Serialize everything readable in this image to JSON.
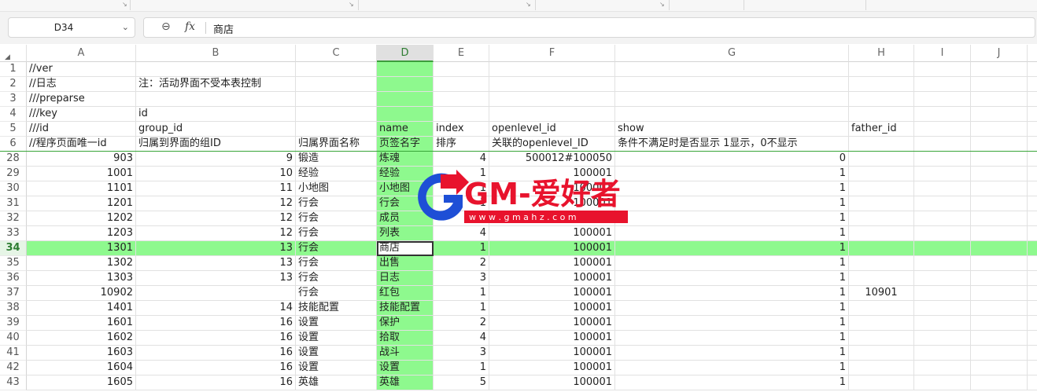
{
  "name_box": {
    "cell_ref": "D34"
  },
  "formula_bar": {
    "content": "商店"
  },
  "icons": {
    "zoom": "zoom-icon",
    "fx": "function-icon",
    "dropdown": "chevron-down-icon"
  },
  "columns": [
    "A",
    "B",
    "C",
    "D",
    "E",
    "F",
    "G",
    "H",
    "I",
    "J"
  ],
  "selected_column": "D",
  "selected_row": "34",
  "colors": {
    "highlight": "#8ef98e",
    "accent": "#2e7d32",
    "logo_red": "#e8132d"
  },
  "header_rows": [
    {
      "num": "1",
      "A": "//ver"
    },
    {
      "num": "2",
      "A": "//日志",
      "B": "注：活动界面不受本表控制"
    },
    {
      "num": "3",
      "A": "///preparse"
    },
    {
      "num": "4",
      "A": "///key",
      "B": "id"
    },
    {
      "num": "5",
      "A": "///id",
      "B": "group_id",
      "D": "name",
      "E": "index",
      "F": "openlevel_id",
      "G": "show",
      "H": "father_id"
    },
    {
      "num": "6",
      "A": "//程序页面唯一id",
      "B": "归属到界面的组ID",
      "C": "归属界面名称",
      "D": "页签名字",
      "E": "排序",
      "F": "关联的openlevel_ID",
      "G": "条件不满足时是否显示 1显示，0不显示"
    }
  ],
  "data_rows": [
    {
      "num": "28",
      "A": "903",
      "B": "9",
      "C": "锻造",
      "D": "炼魂",
      "E": "4",
      "F": "500012#100050",
      "G": "0"
    },
    {
      "num": "29",
      "A": "1001",
      "B": "10",
      "C": "经验",
      "D": "经验",
      "E": "1",
      "F": "100001",
      "G": "1"
    },
    {
      "num": "30",
      "A": "1101",
      "B": "11",
      "C": "小地图",
      "D": "小地图",
      "E": "1",
      "F": "100001",
      "G": "1"
    },
    {
      "num": "31",
      "A": "1201",
      "B": "12",
      "C": "行会",
      "D": "行会",
      "E": "1",
      "F": "100001",
      "G": "1"
    },
    {
      "num": "32",
      "A": "1202",
      "B": "12",
      "C": "行会",
      "D": "成员",
      "E": "2",
      "F": "100001",
      "G": "1"
    },
    {
      "num": "33",
      "A": "1203",
      "B": "12",
      "C": "行会",
      "D": "列表",
      "E": "4",
      "F": "100001",
      "G": "1"
    },
    {
      "num": "34",
      "A": "1301",
      "B": "13",
      "C": "行会",
      "D": "商店",
      "E": "1",
      "F": "100001",
      "G": "1"
    },
    {
      "num": "35",
      "A": "1302",
      "B": "13",
      "C": "行会",
      "D": "出售",
      "E": "2",
      "F": "100001",
      "G": "1"
    },
    {
      "num": "36",
      "A": "1303",
      "B": "13",
      "C": "行会",
      "D": "日志",
      "E": "3",
      "F": "100001",
      "G": "1"
    },
    {
      "num": "37",
      "A": "10902",
      "B": "",
      "C": "行会",
      "D": "红包",
      "E": "1",
      "F": "100001",
      "G": "1",
      "H": "10901"
    },
    {
      "num": "38",
      "A": "1401",
      "B": "14",
      "C": "技能配置",
      "D": "技能配置",
      "E": "1",
      "F": "100001",
      "G": "1"
    },
    {
      "num": "39",
      "A": "1601",
      "B": "16",
      "C": "设置",
      "D": "保护",
      "E": "2",
      "F": "100001",
      "G": "1"
    },
    {
      "num": "40",
      "A": "1602",
      "B": "16",
      "C": "设置",
      "D": "拾取",
      "E": "4",
      "F": "100001",
      "G": "1"
    },
    {
      "num": "41",
      "A": "1603",
      "B": "16",
      "C": "设置",
      "D": "战斗",
      "E": "3",
      "F": "100001",
      "G": "1"
    },
    {
      "num": "42",
      "A": "1604",
      "B": "16",
      "C": "设置",
      "D": "设置",
      "E": "1",
      "F": "100001",
      "G": "1"
    },
    {
      "num": "43",
      "A": "1605",
      "B": "16",
      "C": "英雄",
      "D": "英雄",
      "E": "5",
      "F": "100001",
      "G": "1"
    }
  ],
  "watermark": {
    "brand": "GM-爱好者",
    "url": "w w w . g m a h z . c o m"
  }
}
